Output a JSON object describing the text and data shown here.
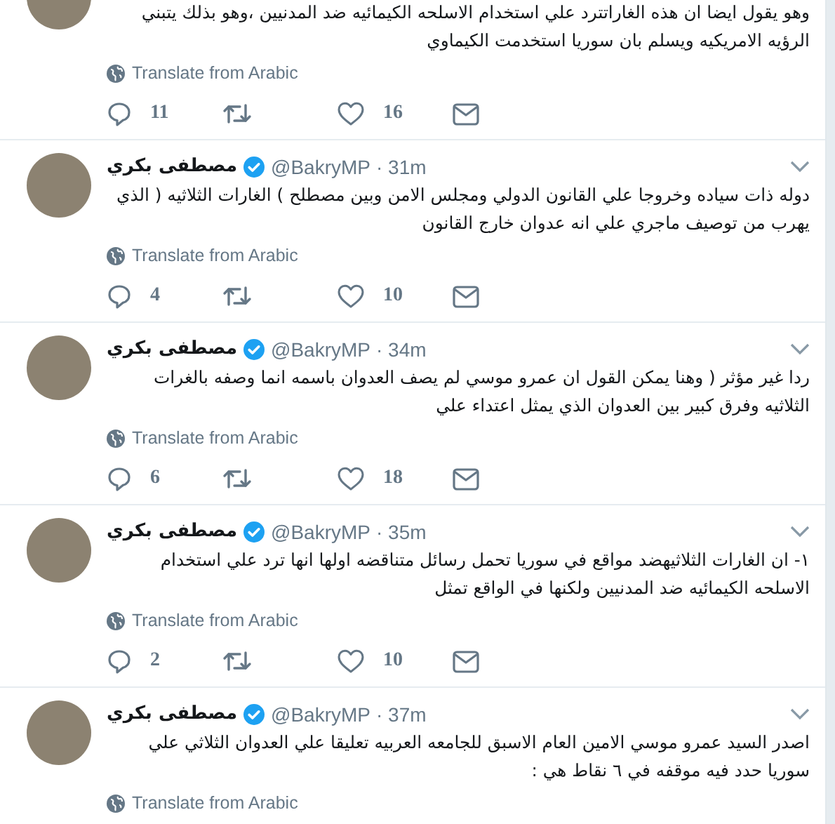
{
  "tweets": [
    {
      "text": "وهو يقول ايضا ان هذه الغاراتترد علي استخدام الاسلحه الكيمائيه ضد المدنيين ،وهو بذلك يتبني الرؤيه الامريكيه ويسلم بان سوريا استخدمت الكيماوي",
      "translate": "Translate from Arabic",
      "replies": "11",
      "likes": "16"
    },
    {
      "name": "مصطفى بكري",
      "verified": true,
      "handle": "@BakryMP",
      "time": "· 31m",
      "text": "دوله ذات سياده وخروجا علي القانون الدولي ومجلس الامن وبين مصطلح ) الغارات الثلاثيه ( الذي يهرب من توصيف ماجري علي انه عدوان خارج القانون",
      "translate": "Translate from Arabic",
      "replies": "4",
      "likes": "10"
    },
    {
      "name": "مصطفى بكري",
      "verified": true,
      "handle": "@BakryMP",
      "time": "· 34m",
      "text": "ردا غير مؤثر ( وهنا يمكن القول ان عمرو موسي لم يصف العدوان باسمه انما وصفه بالغرات الثلاثيه وفرق كبير بين العدوان الذي يمثل اعتداء علي",
      "translate": "Translate from Arabic",
      "replies": "6",
      "likes": "18"
    },
    {
      "name": "مصطفى بكري",
      "verified": true,
      "handle": "@BakryMP",
      "time": "· 35m",
      "text": "١- ان الغارات الثلاثيهضد مواقع في سوريا تحمل رسائل متناقضه اولها انها ترد علي استخدام الاسلحه الكيمائيه ضد المدنيين ولكنها في الواقع تمثل",
      "translate": "Translate from Arabic",
      "replies": "2",
      "likes": "10"
    },
    {
      "name": "مصطفى بكري",
      "verified": true,
      "handle": "@BakryMP",
      "time": "· 37m",
      "text": "اصدر السيد عمرو موسي الامين العام الاسبق للجامعه العربيه تعليقا علي العدوان الثلاثي علي سوريا حدد فيه موقفه في ٦ نقاط هي :",
      "translate": "Translate from Arabic"
    }
  ]
}
